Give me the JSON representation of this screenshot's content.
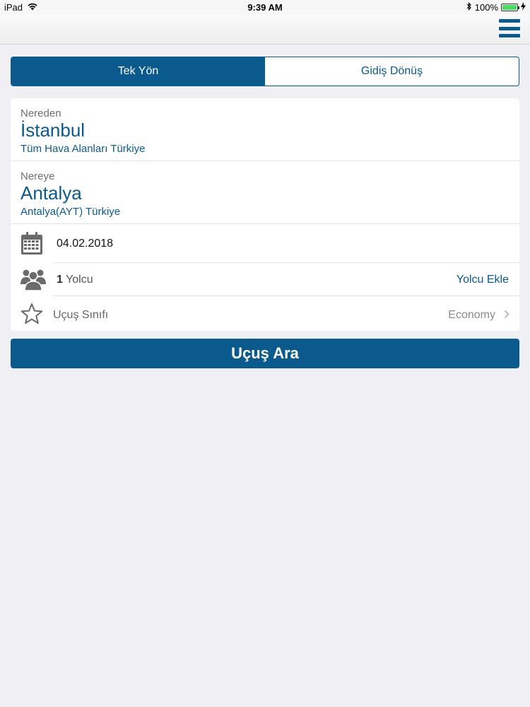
{
  "status_bar": {
    "device": "iPad",
    "time": "9:39 AM",
    "battery": "100%"
  },
  "nav": {
    "menu_icon": "hamburger-menu-icon"
  },
  "trip_type": {
    "tabs": [
      {
        "label": "Tek Yön",
        "active": true
      },
      {
        "label": "Gidiş Dönüş",
        "active": false
      }
    ]
  },
  "form": {
    "from": {
      "label": "Nereden",
      "city": "İstanbul",
      "detail": "Tüm Hava Alanları Türkiye"
    },
    "to": {
      "label": "Nereye",
      "city": "Antalya",
      "detail": "Antalya(AYT) Türkiye"
    },
    "date": {
      "icon": "calendar-icon",
      "value": "04.02.2018"
    },
    "passengers": {
      "icon": "people-icon",
      "count": "1",
      "unit": " Yolcu",
      "add_label": "Yolcu Ekle"
    },
    "cabin_class": {
      "icon": "star-icon",
      "label": "Uçuş Sınıfı",
      "value": "Economy"
    }
  },
  "search_button": {
    "label": "Uçuş Ara"
  },
  "colors": {
    "brand": "#0b5a8e",
    "background": "#efeff4",
    "battery": "#4cd964"
  }
}
